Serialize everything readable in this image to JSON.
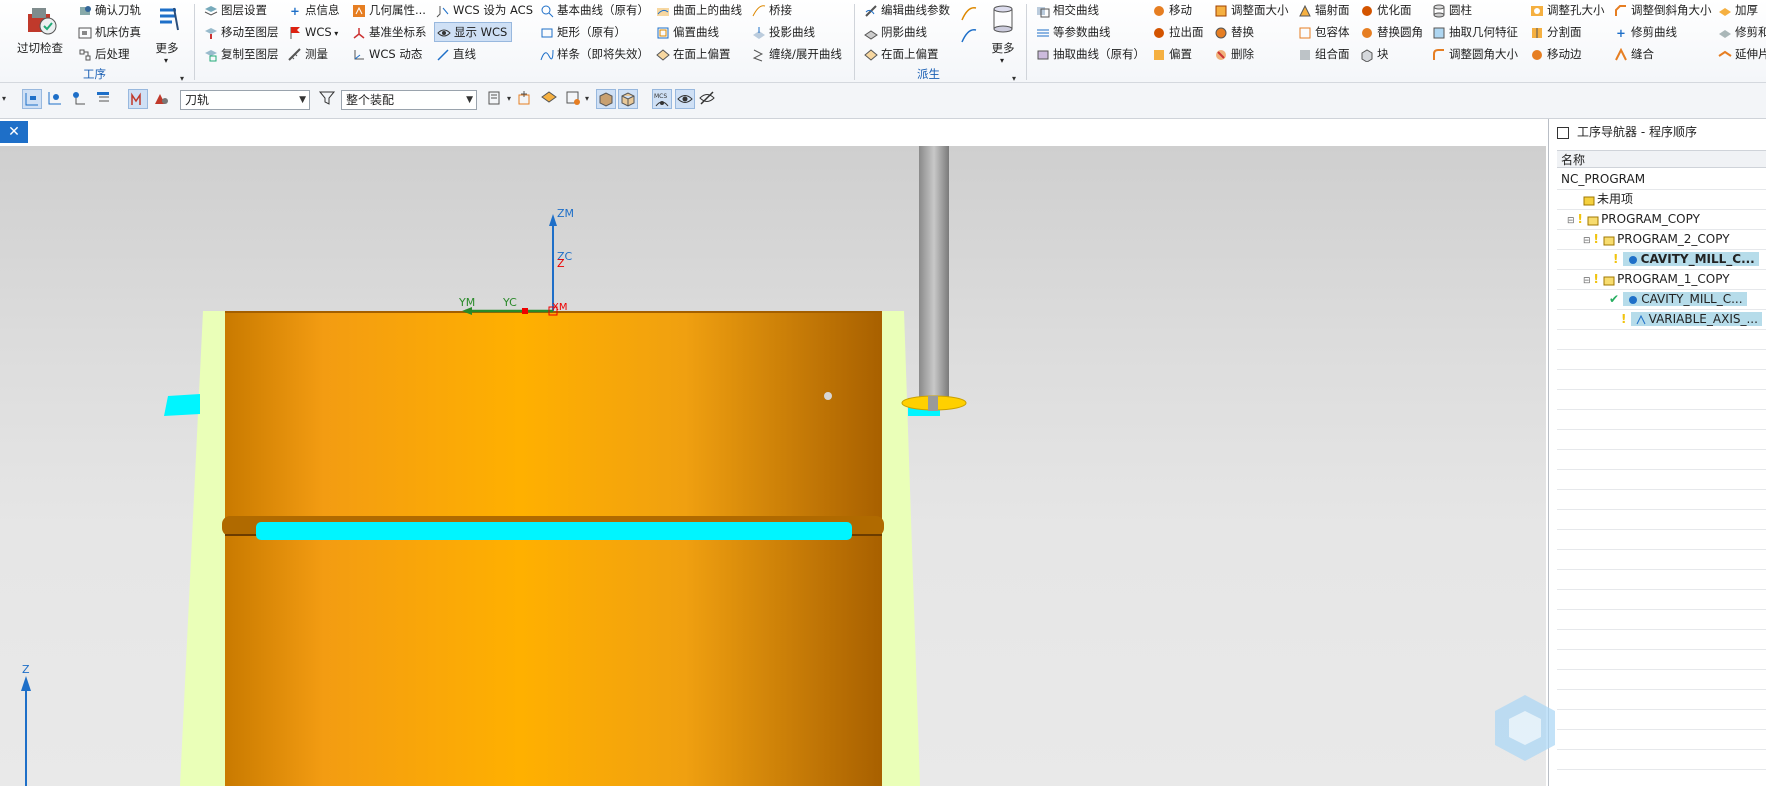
{
  "ribbon": {
    "operation": {
      "toolpath_check": "过切检查",
      "confirm_toolpath": "确认刀轨",
      "machine_sim": "机床仿真",
      "postprocess": "后处理",
      "more": "更多",
      "group_label": "工序"
    },
    "utility": {
      "layer_settings": "图层设置",
      "move_to_layer": "移动至图层",
      "copy_to_layer": "复制至图层",
      "point_info": "点信息",
      "wcs": "WCS",
      "measure": "测量",
      "geom_props": "几何属性...",
      "datum_csys": "基准坐标系",
      "wcs_dynamic": "WCS 动态",
      "wcs_set_acs": "WCS 设为 ACS",
      "show_wcs": "显示 WCS",
      "line": "直线"
    },
    "curve": {
      "basic_curve": "基本曲线（原有）",
      "rectangle": "矩形（原有）",
      "spline": "样条（即将失效）",
      "curve_on_surface": "曲面上的曲线",
      "offset_curve": "偏置曲线",
      "offset_in_face": "在面上偏置",
      "bridge": "桥接",
      "project_curve": "投影曲线",
      "wrap_unwrap": "缠绕/展开曲线"
    },
    "derived": {
      "edit_curve_params": "编辑曲线参数",
      "shadow_curve": "阴影曲线",
      "offset_in_face2": "在面上偏置",
      "more": "更多",
      "group_label": "派生"
    },
    "synchronous": {
      "intersect_curve": "相交曲线",
      "isoparametric_curve": "等参数曲线",
      "extract_curve": "抽取曲线（原有）",
      "move": "移动",
      "pull_face": "拉出面",
      "offset": "偏置",
      "resize_face": "调整面大小",
      "replace": "替换",
      "delete": "删除",
      "radiate_face": "辐射面",
      "contain_body": "包容体",
      "combine_face": "组合面",
      "optimize_face": "优化面",
      "replace_blend": "替换圆角",
      "block": "块",
      "cylinder": "圆柱",
      "extract_geom": "抽取几何特征",
      "resize_blend": "调整圆角大小",
      "resize_hole": "调整孔大小",
      "split_face": "分割面",
      "move_edge": "移动边",
      "resize_chamfer": "调整倒斜角大小",
      "trim_curve": "修剪曲线",
      "sew": "缝合",
      "thicken": "加厚",
      "repair": "修剪和",
      "extend_sheet": "延伸片"
    }
  },
  "toolbar": {
    "filter_value": "刀轨",
    "assembly_value": "整个装配"
  },
  "viewport": {
    "axis_labels": {
      "zm": "ZM",
      "zc": "ZC",
      "z": "Z",
      "ym": "YM",
      "yc": "YC",
      "xm": "XM",
      "z_corner": "Z"
    },
    "colors": {
      "part": "#f0a010",
      "blank": "#eaffb8",
      "toolpath": "#00f5ff",
      "tool": "#9a9a9a",
      "tool_tip": "#ffd000",
      "accent": "#1e6fc8"
    }
  },
  "navigator": {
    "title": "工序导航器 - 程序顺序",
    "column_name": "名称",
    "rows": [
      {
        "label": "NC_PROGRAM",
        "level": 0
      },
      {
        "label": "未用项",
        "level": 1
      },
      {
        "label": "PROGRAM_COPY",
        "level": 1
      },
      {
        "label": "PROGRAM_2_COPY",
        "level": 2
      },
      {
        "label": "CAVITY_MILL_C...",
        "level": 3
      },
      {
        "label": "PROGRAM_1_COPY",
        "level": 2
      },
      {
        "label": "CAVITY_MILL_C...",
        "level": 3
      },
      {
        "label": "VARIABLE_AXIS_...",
        "level": 3
      }
    ]
  }
}
